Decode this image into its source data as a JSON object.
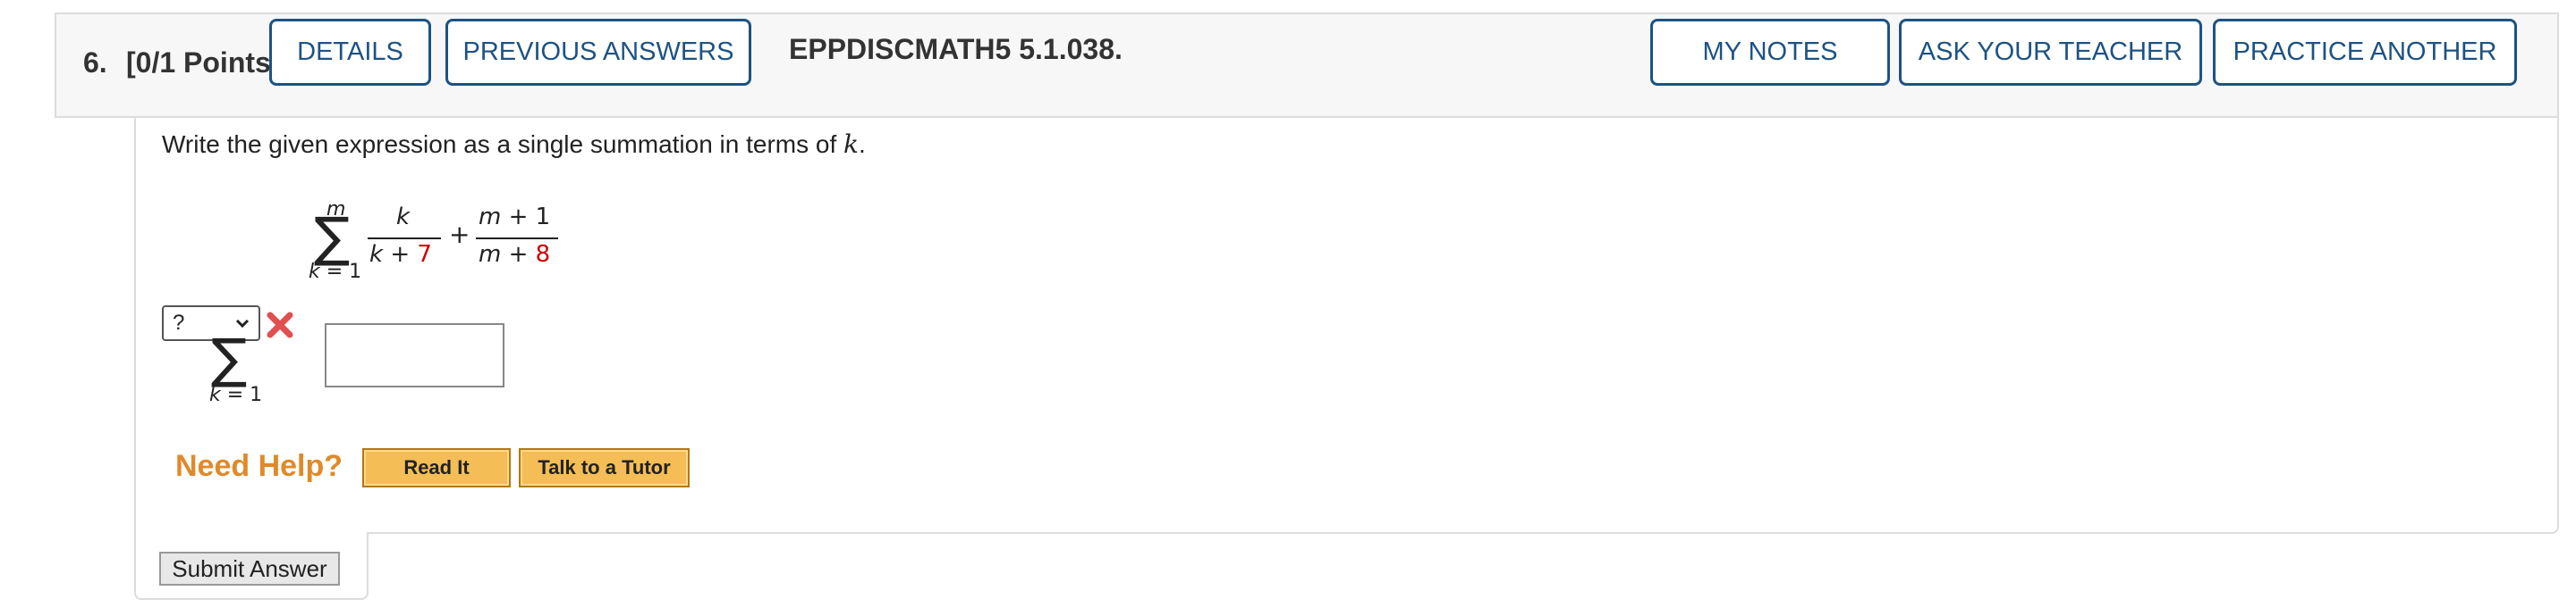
{
  "header": {
    "question_number": "6.",
    "points": "[0/1 Points]",
    "details_label": "DETAILS",
    "previous_answers_label": "PREVIOUS ANSWERS",
    "problem_code": "EPPDISCMATH5 5.1.038.",
    "my_notes_label": "MY NOTES",
    "ask_teacher_label": "ASK YOUR TEACHER",
    "practice_another_label": "PRACTICE ANOTHER"
  },
  "question": {
    "prompt_before": "Write the given expression as a single summation in terms of ",
    "prompt_var": "k",
    "prompt_after": ".",
    "expression": {
      "sum_upper": "m",
      "sum_symbol": "∑",
      "sum_lower": "k = 1",
      "frac1_num": "k",
      "frac1_den_var": "k + ",
      "frac1_den_num": "7",
      "plus": "+",
      "frac2_num": "m + 1",
      "frac2_den_var": "m + ",
      "frac2_den_num": "8"
    },
    "answer": {
      "upper_limit_selected": "?",
      "sum_symbol": "∑",
      "sum_lower": "k = 1",
      "status": "incorrect-icon",
      "input_value": ""
    }
  },
  "help": {
    "label": "Need Help?",
    "read_it_label": "Read It",
    "tutor_label": "Talk to a Tutor"
  },
  "submit_label": "Submit Answer",
  "colors": {
    "accent_blue": "#1d5283",
    "help_orange": "#e08a2a",
    "help_button": "#f5bd55",
    "incorrect_red": "#e05050",
    "constant_red": "#cc0000"
  }
}
